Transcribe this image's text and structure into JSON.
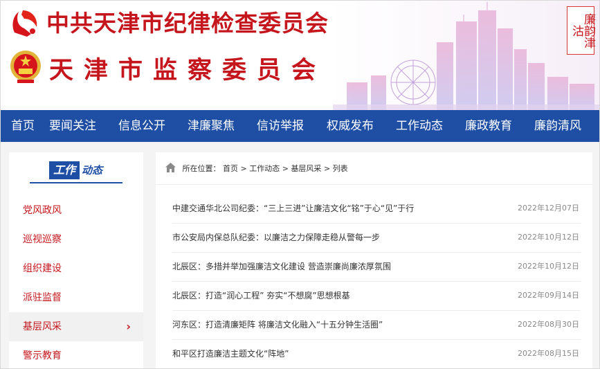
{
  "header": {
    "title_top": "中共天津市纪律检查委员会",
    "title_bottom": "天津市监察委员会",
    "seal_text": "廉韵津沽"
  },
  "nav": {
    "items": [
      {
        "label": "首页"
      },
      {
        "label": "要闻关注"
      },
      {
        "label": "信息公开"
      },
      {
        "label": "津廉聚焦"
      },
      {
        "label": "信访举报"
      },
      {
        "label": "权威发布"
      },
      {
        "label": "工作动态"
      },
      {
        "label": "廉政教育"
      },
      {
        "label": "廉韵清风"
      }
    ]
  },
  "sidebar": {
    "heading_highlight": "工作",
    "heading_rest": "动态",
    "items": [
      {
        "label": "党风政风"
      },
      {
        "label": "巡视巡察"
      },
      {
        "label": "组织建设"
      },
      {
        "label": "派驻监督"
      },
      {
        "label": "基层风采",
        "active": true
      },
      {
        "label": "警示教育"
      }
    ],
    "active_arrow": "›"
  },
  "breadcrumb": {
    "prefix": "所在位置：",
    "items": [
      "首页",
      "工作动态",
      "基层风采",
      "列表"
    ],
    "separator": ">"
  },
  "articles": [
    {
      "title": "中建交通华北公司纪委：“三上三进”让廉洁文化“铭”于心“见”于行",
      "date": "2022年12月07日"
    },
    {
      "title": "市公安局内保总队纪委：以廉洁之力保障走稳从警每一步",
      "date": "2022年10月12日"
    },
    {
      "title": "北辰区：多措并举加强廉洁文化建设 营造崇廉尚廉浓厚氛围",
      "date": "2022年10月12日"
    },
    {
      "title": "北辰区：打造“润心工程” 夯实“不想腐”思想根基",
      "date": "2022年09月14日"
    },
    {
      "title": "河东区：打造清廉矩阵 将廉洁文化融入“十五分钟生活圈”",
      "date": "2022年08月30日"
    },
    {
      "title": "和平区打造廉洁主题文化“阵地”",
      "date": "2022年08月15日"
    }
  ],
  "colors": {
    "brand_red": "#c4161c",
    "nav_blue": "#1f4fa5"
  }
}
